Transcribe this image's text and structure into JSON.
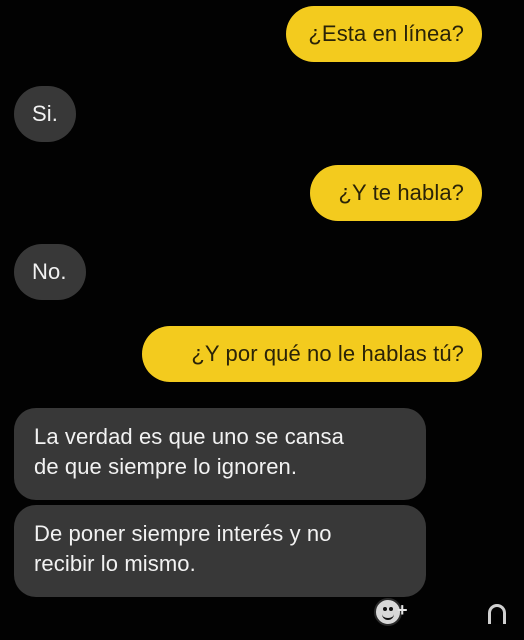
{
  "messages": [
    {
      "direction": "outgoing",
      "text": "¿Esta en línea?"
    },
    {
      "direction": "incoming",
      "text": "Si."
    },
    {
      "direction": "outgoing",
      "text": "¿Y te habla?"
    },
    {
      "direction": "incoming",
      "text": "No."
    },
    {
      "direction": "outgoing",
      "text": "¿Y por qué no le hablas tú?"
    },
    {
      "direction": "incoming",
      "lines": [
        "La verdad es que uno se cansa",
        "de que siempre lo ignoren."
      ]
    },
    {
      "direction": "incoming",
      "lines": [
        "De poner siempre interés y no",
        "recibir lo mismo."
      ]
    }
  ],
  "footer": {
    "plus_label": "+",
    "icons": [
      "emoji-icon",
      "ghost-icon"
    ]
  },
  "colors": {
    "background": "#000000",
    "outgoing_bubble": "#f3cb1e",
    "incoming_bubble": "#383838",
    "incoming_text": "#f2f2f2",
    "outgoing_text": "#2a2308"
  }
}
